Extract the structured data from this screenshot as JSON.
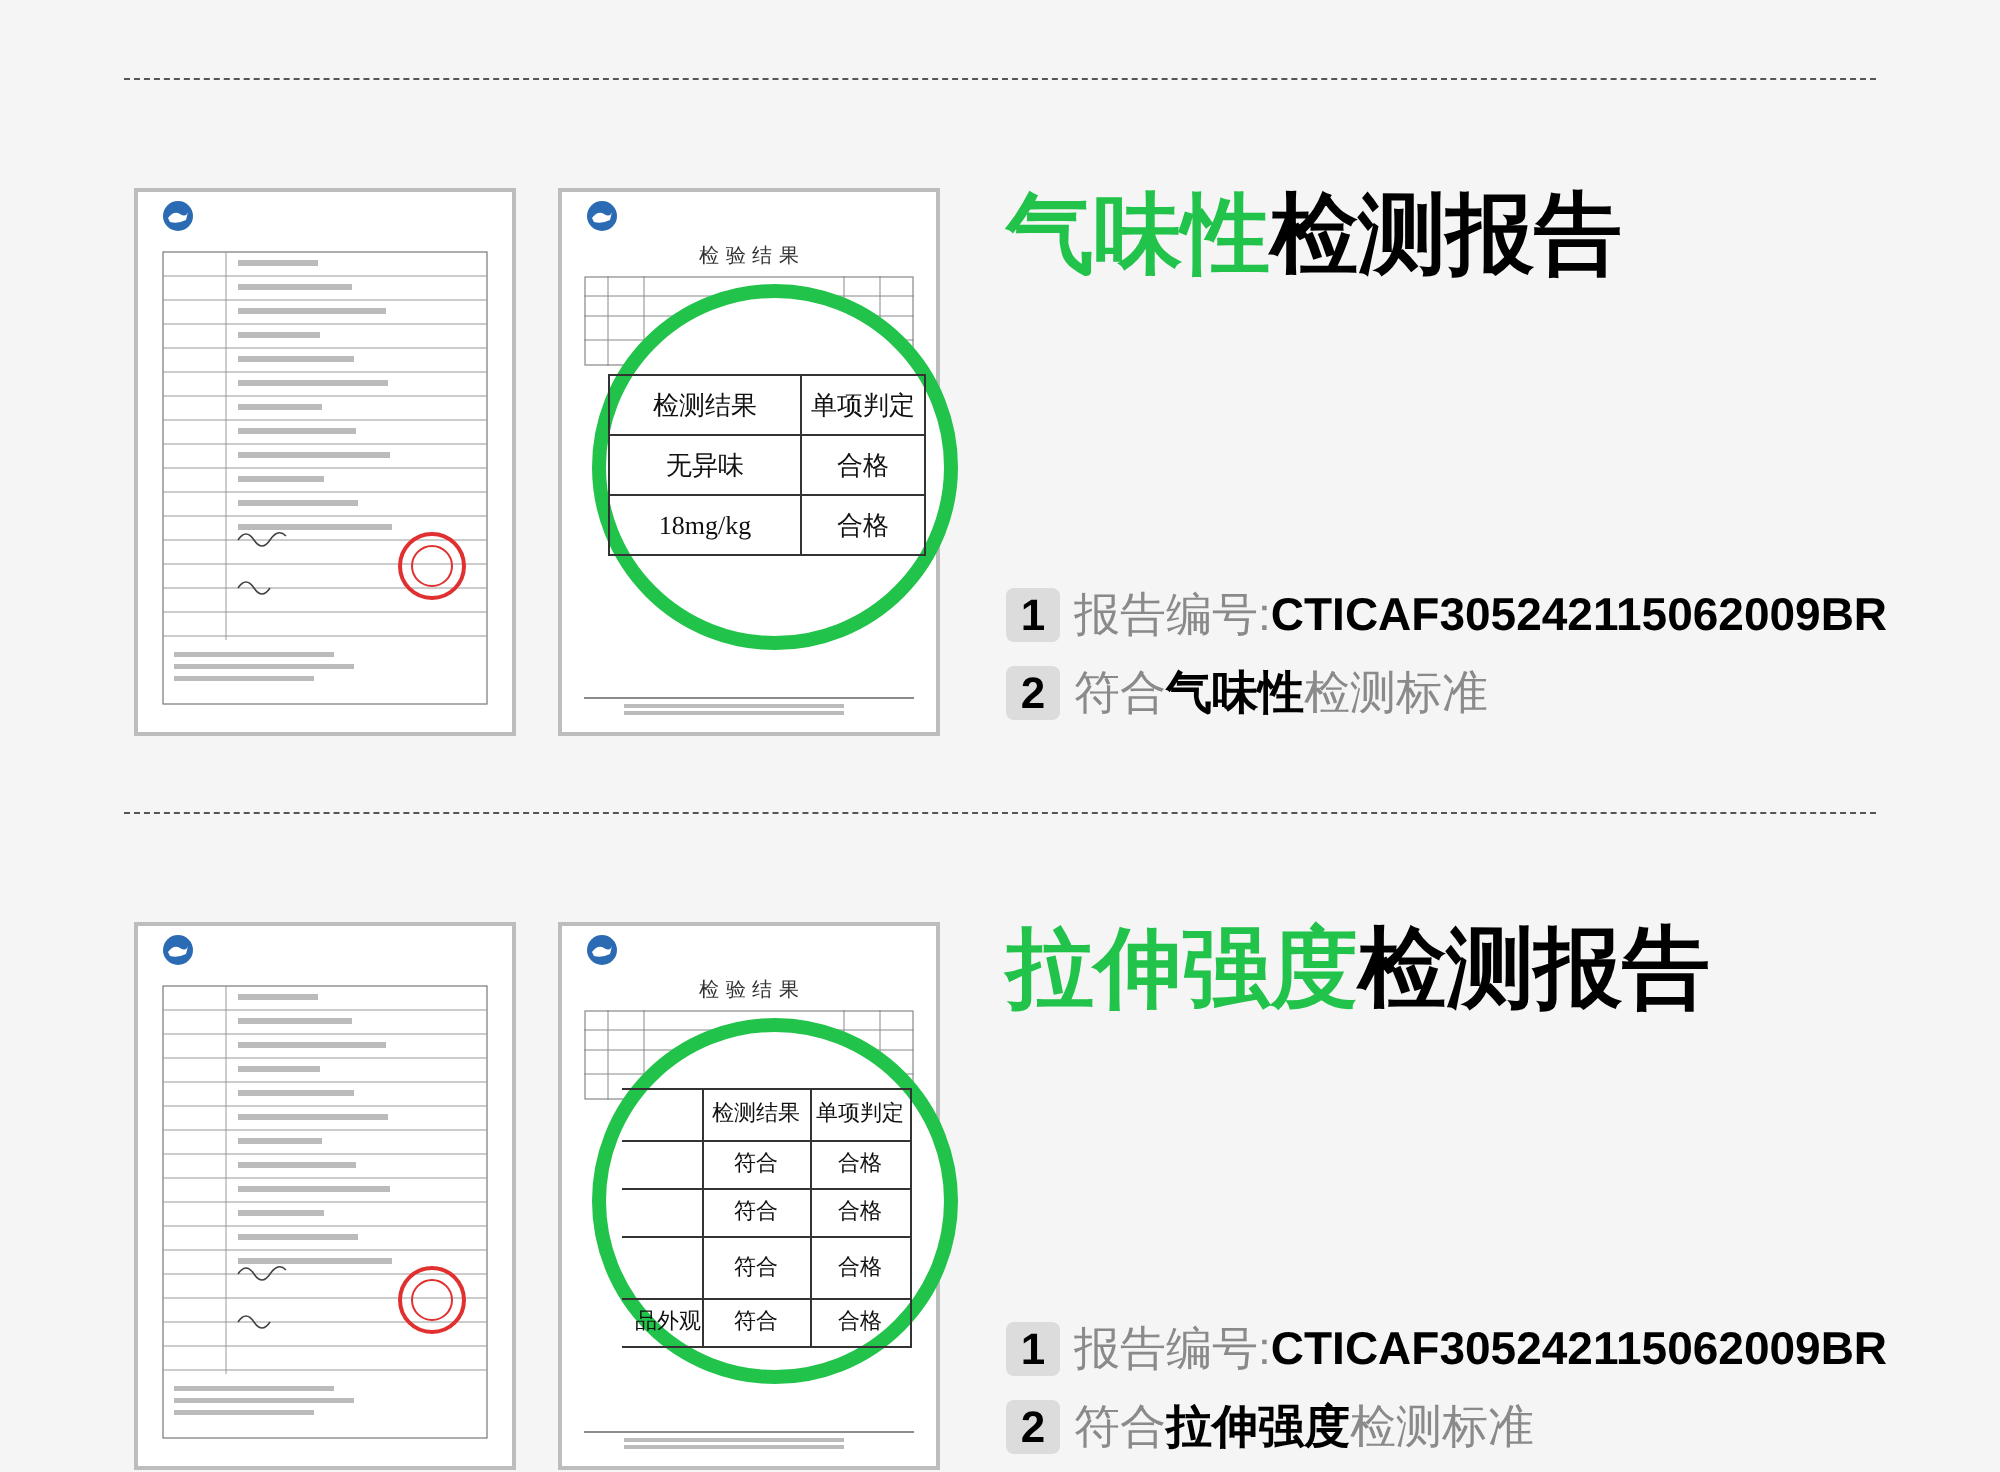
{
  "sections": [
    {
      "title": {
        "highlight": "气味性",
        "rest": "检测报告"
      },
      "document_title": "检 验 结 果",
      "magnified_table": {
        "rows": [
          {
            "cells": [
              "检测结果",
              "单项判定"
            ]
          },
          {
            "cells": [
              "无异味",
              "合格"
            ]
          },
          {
            "cells": [
              "18mg/kg",
              "合格"
            ]
          }
        ]
      },
      "items": [
        {
          "number": "1",
          "text": "报告编号:**CTICAF305242115062009BR**"
        },
        {
          "number": "2",
          "text": "符合**气味性**检测标准"
        }
      ]
    },
    {
      "title": {
        "highlight": "拉伸强度",
        "rest": "检测报告"
      },
      "document_title": "检 验 结 果",
      "magnified_table": {
        "rows": [
          {
            "cells": [
              "",
              "检测结果",
              "单项判定"
            ]
          },
          {
            "cells": [
              "",
              "符合",
              "合格"
            ]
          },
          {
            "cells": [
              "",
              "符合",
              "合格"
            ]
          },
          {
            "cells": [
              "",
              "符合",
              "合格"
            ]
          },
          {
            "cells": [
              "品外观",
              "符合",
              "合格"
            ]
          }
        ]
      },
      "items": [
        {
          "number": "1",
          "text": "报告编号:**CTICAF305242115062009BR**"
        },
        {
          "number": "2",
          "text": "符合**拉伸强度**检测标准"
        }
      ]
    }
  ]
}
